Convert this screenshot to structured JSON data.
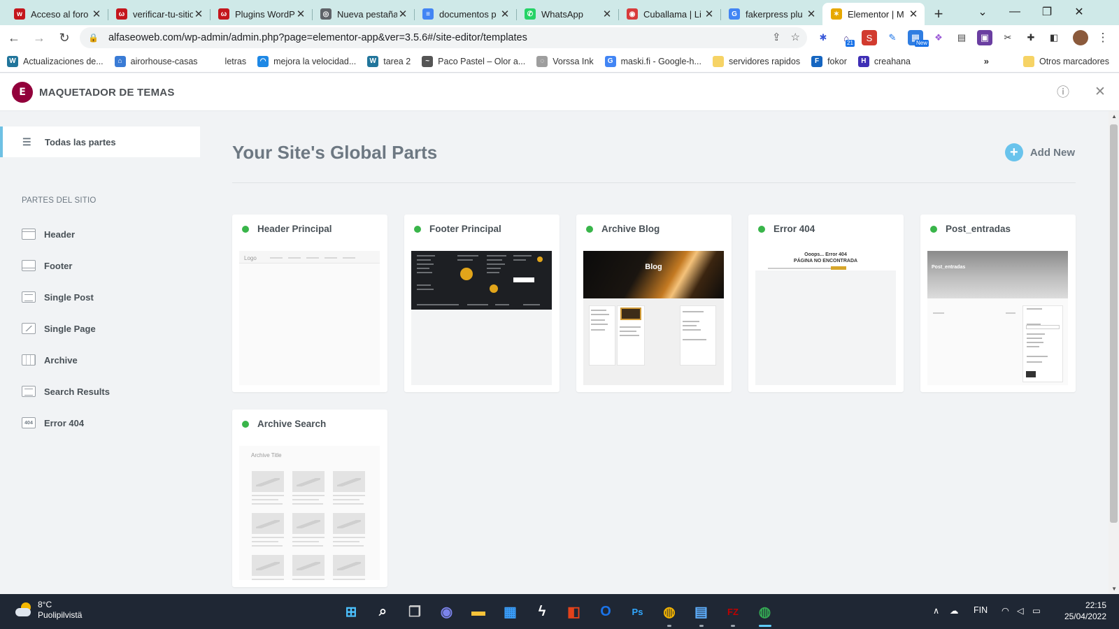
{
  "browser": {
    "tabs": [
      {
        "title": "Acceso al foro",
        "favicon_color": "#c4161c",
        "favicon_glyph": "w",
        "active": false
      },
      {
        "title": "verificar-tu-sitio",
        "favicon_color": "#c4161c",
        "favicon_glyph": "ω",
        "active": false
      },
      {
        "title": "Plugins WordPress",
        "favicon_color": "#c4161c",
        "favicon_glyph": "ω",
        "active": false
      },
      {
        "title": "Nueva pestaña",
        "favicon_color": "#5f6368",
        "favicon_glyph": "◎",
        "active": false
      },
      {
        "title": "documentos p",
        "favicon_color": "#4285f4",
        "favicon_glyph": "≡",
        "active": false
      },
      {
        "title": "WhatsApp",
        "favicon_color": "#25d366",
        "favicon_glyph": "✆",
        "active": false
      },
      {
        "title": "Cuballama | Li",
        "favicon_color": "#d83b3b",
        "favicon_glyph": "◉",
        "active": false
      },
      {
        "title": "fakerpress plu",
        "favicon_color": "#4285f4",
        "favicon_glyph": "G",
        "active": false
      },
      {
        "title": "Elementor | M",
        "favicon_color": "#e7a800",
        "favicon_glyph": "✶",
        "active": true
      }
    ],
    "new_tab_glyph": "+",
    "window_controls": {
      "dropdown": "⌄",
      "minimize": "—",
      "restore": "❐",
      "close": "✕"
    },
    "nav": {
      "back": "←",
      "forward": "→",
      "reload": "↻"
    },
    "url": "alfaseoweb.com/wp-admin/admin.php?page=elementor-app&ver=3.5.6#/site-editor/templates",
    "omnibox_icons": {
      "lock": "🔒",
      "share": "⇪",
      "star": "☆"
    },
    "extensions": [
      {
        "name": "bug-extension",
        "glyph": "✱",
        "color": "#3b5bd9",
        "bg": "transparent"
      },
      {
        "name": "school-extension",
        "glyph": "⌂",
        "color": "#3e2a8a",
        "bg": "transparent",
        "badge": "21"
      },
      {
        "name": "seo-extension",
        "glyph": "S",
        "color": "#ffffff",
        "bg": "#d23b2f"
      },
      {
        "name": "pen-extension",
        "glyph": "✎",
        "color": "#1a73e8",
        "bg": "transparent"
      },
      {
        "name": "new-extension",
        "glyph": "▦",
        "color": "#ffffff",
        "bg": "#2f7de1",
        "badge": "New"
      },
      {
        "name": "paint-extension",
        "glyph": "❖",
        "color": "#9b59d6",
        "bg": "transparent"
      },
      {
        "name": "doc-extension",
        "glyph": "▤",
        "color": "#444444",
        "bg": "transparent"
      },
      {
        "name": "image-extension",
        "glyph": "▣",
        "color": "#ffffff",
        "bg": "#6a3ea1"
      },
      {
        "name": "scissors-extension",
        "glyph": "✂",
        "color": "#333333",
        "bg": "transparent"
      },
      {
        "name": "puzzle-extension",
        "glyph": "✚",
        "color": "#333333",
        "bg": "transparent"
      },
      {
        "name": "sidepanel-extension",
        "glyph": "◧",
        "color": "#333333",
        "bg": "transparent"
      }
    ],
    "menu_glyph": "⋮",
    "bookmarks": [
      {
        "label": "Actualizaciones de...",
        "icon_color": "#21759b",
        "glyph": "W"
      },
      {
        "label": "airorhouse-casas",
        "icon_color": "#3a7bd5",
        "glyph": "⌂"
      },
      {
        "label": "letras",
        "icon_color": "transparent",
        "glyph": ""
      },
      {
        "label": "mejora la velocidad...",
        "icon_color": "#1e88e5",
        "glyph": "◠"
      },
      {
        "label": "tarea 2",
        "icon_color": "#21759b",
        "glyph": "W"
      },
      {
        "label": "Paco Pastel – Olor a...",
        "icon_color": "#555555",
        "glyph": "~"
      },
      {
        "label": "Vorssa Ink",
        "icon_color": "#9e9e9e",
        "glyph": "◌"
      },
      {
        "label": "maski.fi - Google-h...",
        "icon_color": "#4285f4",
        "glyph": "G"
      },
      {
        "label": "servidores rapidos",
        "icon_color": "#f6d365",
        "glyph": ""
      },
      {
        "label": "fokor",
        "icon_color": "#1565c0",
        "glyph": "F"
      },
      {
        "label": "creahana",
        "icon_color": "#3f2fb5",
        "glyph": "H"
      }
    ],
    "bookmarks_more": "»",
    "other_bookmarks": "Otros marcadores"
  },
  "app": {
    "logo_glyph": "E",
    "title": "MAQUETADOR DE TEMAS",
    "info_icon": "ⓘ",
    "close_icon": "✕",
    "brand_color": "#92003b",
    "accent_color": "#6ec1e4"
  },
  "sidebar": {
    "all_parts": "Todas las partes",
    "section_title": "PARTES DEL SITIO",
    "items": [
      {
        "label": "Header",
        "icon": "header-icon"
      },
      {
        "label": "Footer",
        "icon": "footer-icon"
      },
      {
        "label": "Single Post",
        "icon": "single-post-icon"
      },
      {
        "label": "Single Page",
        "icon": "single-page-icon"
      },
      {
        "label": "Archive",
        "icon": "archive-icon"
      },
      {
        "label": "Search Results",
        "icon": "search-results-icon"
      },
      {
        "label": "Error 404",
        "icon": "error-404-icon",
        "icon_text": "404"
      }
    ]
  },
  "main": {
    "title": "Your Site's Global Parts",
    "add_new": "Add New",
    "status_color": "#39b54a",
    "cards": [
      {
        "title": "Header Principal",
        "thumb": "header"
      },
      {
        "title": "Footer Principal",
        "thumb": "footer"
      },
      {
        "title": "Archive Blog",
        "thumb": "blog"
      },
      {
        "title": "Error 404",
        "thumb": "error"
      },
      {
        "title": "Post_entradas",
        "thumb": "post"
      },
      {
        "title": "Archive Search",
        "thumb": "search"
      }
    ],
    "thumb_text": {
      "logo": "Logo",
      "blog": "Blog",
      "error_line1": "Ooops... Error 404",
      "error_line2": "PÁGINA NO ENCONTRADA",
      "post": "Post_entradas",
      "archive_title": "Archive Title"
    }
  },
  "taskbar": {
    "weather_temp": "8°C",
    "weather_desc": "Puolipilvistä",
    "language": "FIN",
    "time": "22:15",
    "date": "25/04/2022",
    "apps": [
      {
        "name": "windows-start",
        "glyph": "⊞",
        "color": "#4cc2ff"
      },
      {
        "name": "search",
        "glyph": "⌕",
        "color": "#ffffff"
      },
      {
        "name": "task-view",
        "glyph": "❐",
        "color": "#d0d0d0"
      },
      {
        "name": "teams-chat",
        "glyph": "◉",
        "color": "#7b83eb"
      },
      {
        "name": "file-explorer",
        "glyph": "▬",
        "color": "#f8c33a"
      },
      {
        "name": "microsoft-store",
        "glyph": "▦",
        "color": "#3aa0ff"
      },
      {
        "name": "winscp",
        "glyph": "ϟ",
        "color": "#ffffff"
      },
      {
        "name": "office",
        "glyph": "◧",
        "color": "#e3421b"
      },
      {
        "name": "outlook",
        "glyph": "O",
        "color": "#1a73e8"
      },
      {
        "name": "photoshop",
        "glyph": "Ps",
        "color": "#31a8ff"
      },
      {
        "name": "chrome-canary",
        "glyph": "◍",
        "color": "#f4b400"
      },
      {
        "name": "notepad",
        "glyph": "▤",
        "color": "#5fb0ff"
      },
      {
        "name": "filezilla",
        "glyph": "FZ",
        "color": "#bf0000"
      },
      {
        "name": "chrome",
        "glyph": "◍",
        "color": "#34a853"
      }
    ]
  }
}
